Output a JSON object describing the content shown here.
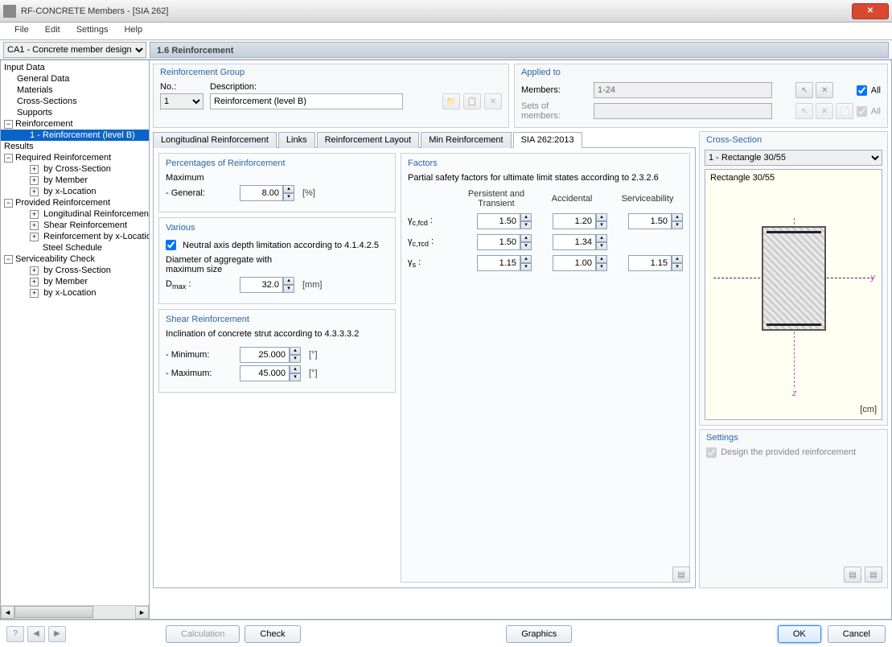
{
  "window": {
    "title": "RF-CONCRETE Members - [SIA 262]"
  },
  "menu": {
    "file": "File",
    "edit": "Edit",
    "settings": "Settings",
    "help": "Help"
  },
  "topbar": {
    "combo": "CA1 - Concrete member design",
    "page_title": "1.6 Reinforcement"
  },
  "tree": {
    "input_data": "Input Data",
    "general_data": "General Data",
    "materials": "Materials",
    "cross_sections": "Cross-Sections",
    "supports": "Supports",
    "reinforcement": "Reinforcement",
    "reinf_item": "1 - Reinforcement (level B)",
    "results": "Results",
    "req_reinf": "Required Reinforcement",
    "by_cs": "by Cross-Section",
    "by_member": "by Member",
    "by_xloc": "by x-Location",
    "prov_reinf": "Provided Reinforcement",
    "long_reinf": "Longitudinal Reinforcement",
    "shear_reinf": "Shear Reinforcement",
    "reinf_by_x": "Reinforcement by x-Location",
    "steel_sched": "Steel Schedule",
    "serv_check": "Serviceability Check"
  },
  "group_panel": {
    "title": "Reinforcement Group",
    "no_label": "No.:",
    "no_value": "1",
    "desc_label": "Description:",
    "desc_value": "Reinforcement (level B)"
  },
  "applied": {
    "title": "Applied to",
    "members_label": "Members:",
    "members_value": "1-24",
    "sets_label": "Sets of members:",
    "all": "All"
  },
  "tabs": {
    "long": "Longitudinal Reinforcement",
    "links": "Links",
    "layout": "Reinforcement Layout",
    "min": "Min Reinforcement",
    "sia": "SIA 262:2013"
  },
  "percentages": {
    "title": "Percentages of Reinforcement",
    "max": "Maximum",
    "general": "- General:",
    "general_val": "8.00",
    "general_unit": "[%]"
  },
  "various": {
    "title": "Various",
    "neutral": "Neutral axis depth limitation according to 4.1.4.2.5",
    "diam_label1": "Diameter of aggregate with",
    "diam_label2": "maximum size",
    "dmax": "Dmax :",
    "dmax_val": "32.0",
    "dmax_unit": "[mm]"
  },
  "shear": {
    "title": "Shear Reinforcement",
    "incl": "Inclination of concrete strut according to 4.3.3.3.2",
    "min": "- Minimum:",
    "min_val": "25.000",
    "max": "- Maximum:",
    "max_val": "45.000",
    "unit": "[°]"
  },
  "factors": {
    "title": "Factors",
    "desc": "Partial safety factors for ultimate limit states according to 2.3.2.6",
    "h1": "Persistent and Transient",
    "h2": "Accidental",
    "h3": "Serviceability",
    "r1": "γc,fcd :",
    "r1v1": "1.50",
    "r1v2": "1.20",
    "r1v3": "1.50",
    "r2": "γc,τcd :",
    "r2v1": "1.50",
    "r2v2": "1.34",
    "r3": "γs :",
    "r3v1": "1.15",
    "r3v2": "1.00",
    "r3v3": "1.15"
  },
  "cs": {
    "title": "Cross-Section",
    "combo": "1 - Rectangle 30/55",
    "name": "Rectangle 30/55",
    "y": "y",
    "z": "z",
    "unit": "[cm]"
  },
  "settings_panel": {
    "title": "Settings",
    "design": "Design the provided reinforcement"
  },
  "footer": {
    "calc": "Calculation",
    "check": "Check",
    "graphics": "Graphics",
    "ok": "OK",
    "cancel": "Cancel"
  }
}
